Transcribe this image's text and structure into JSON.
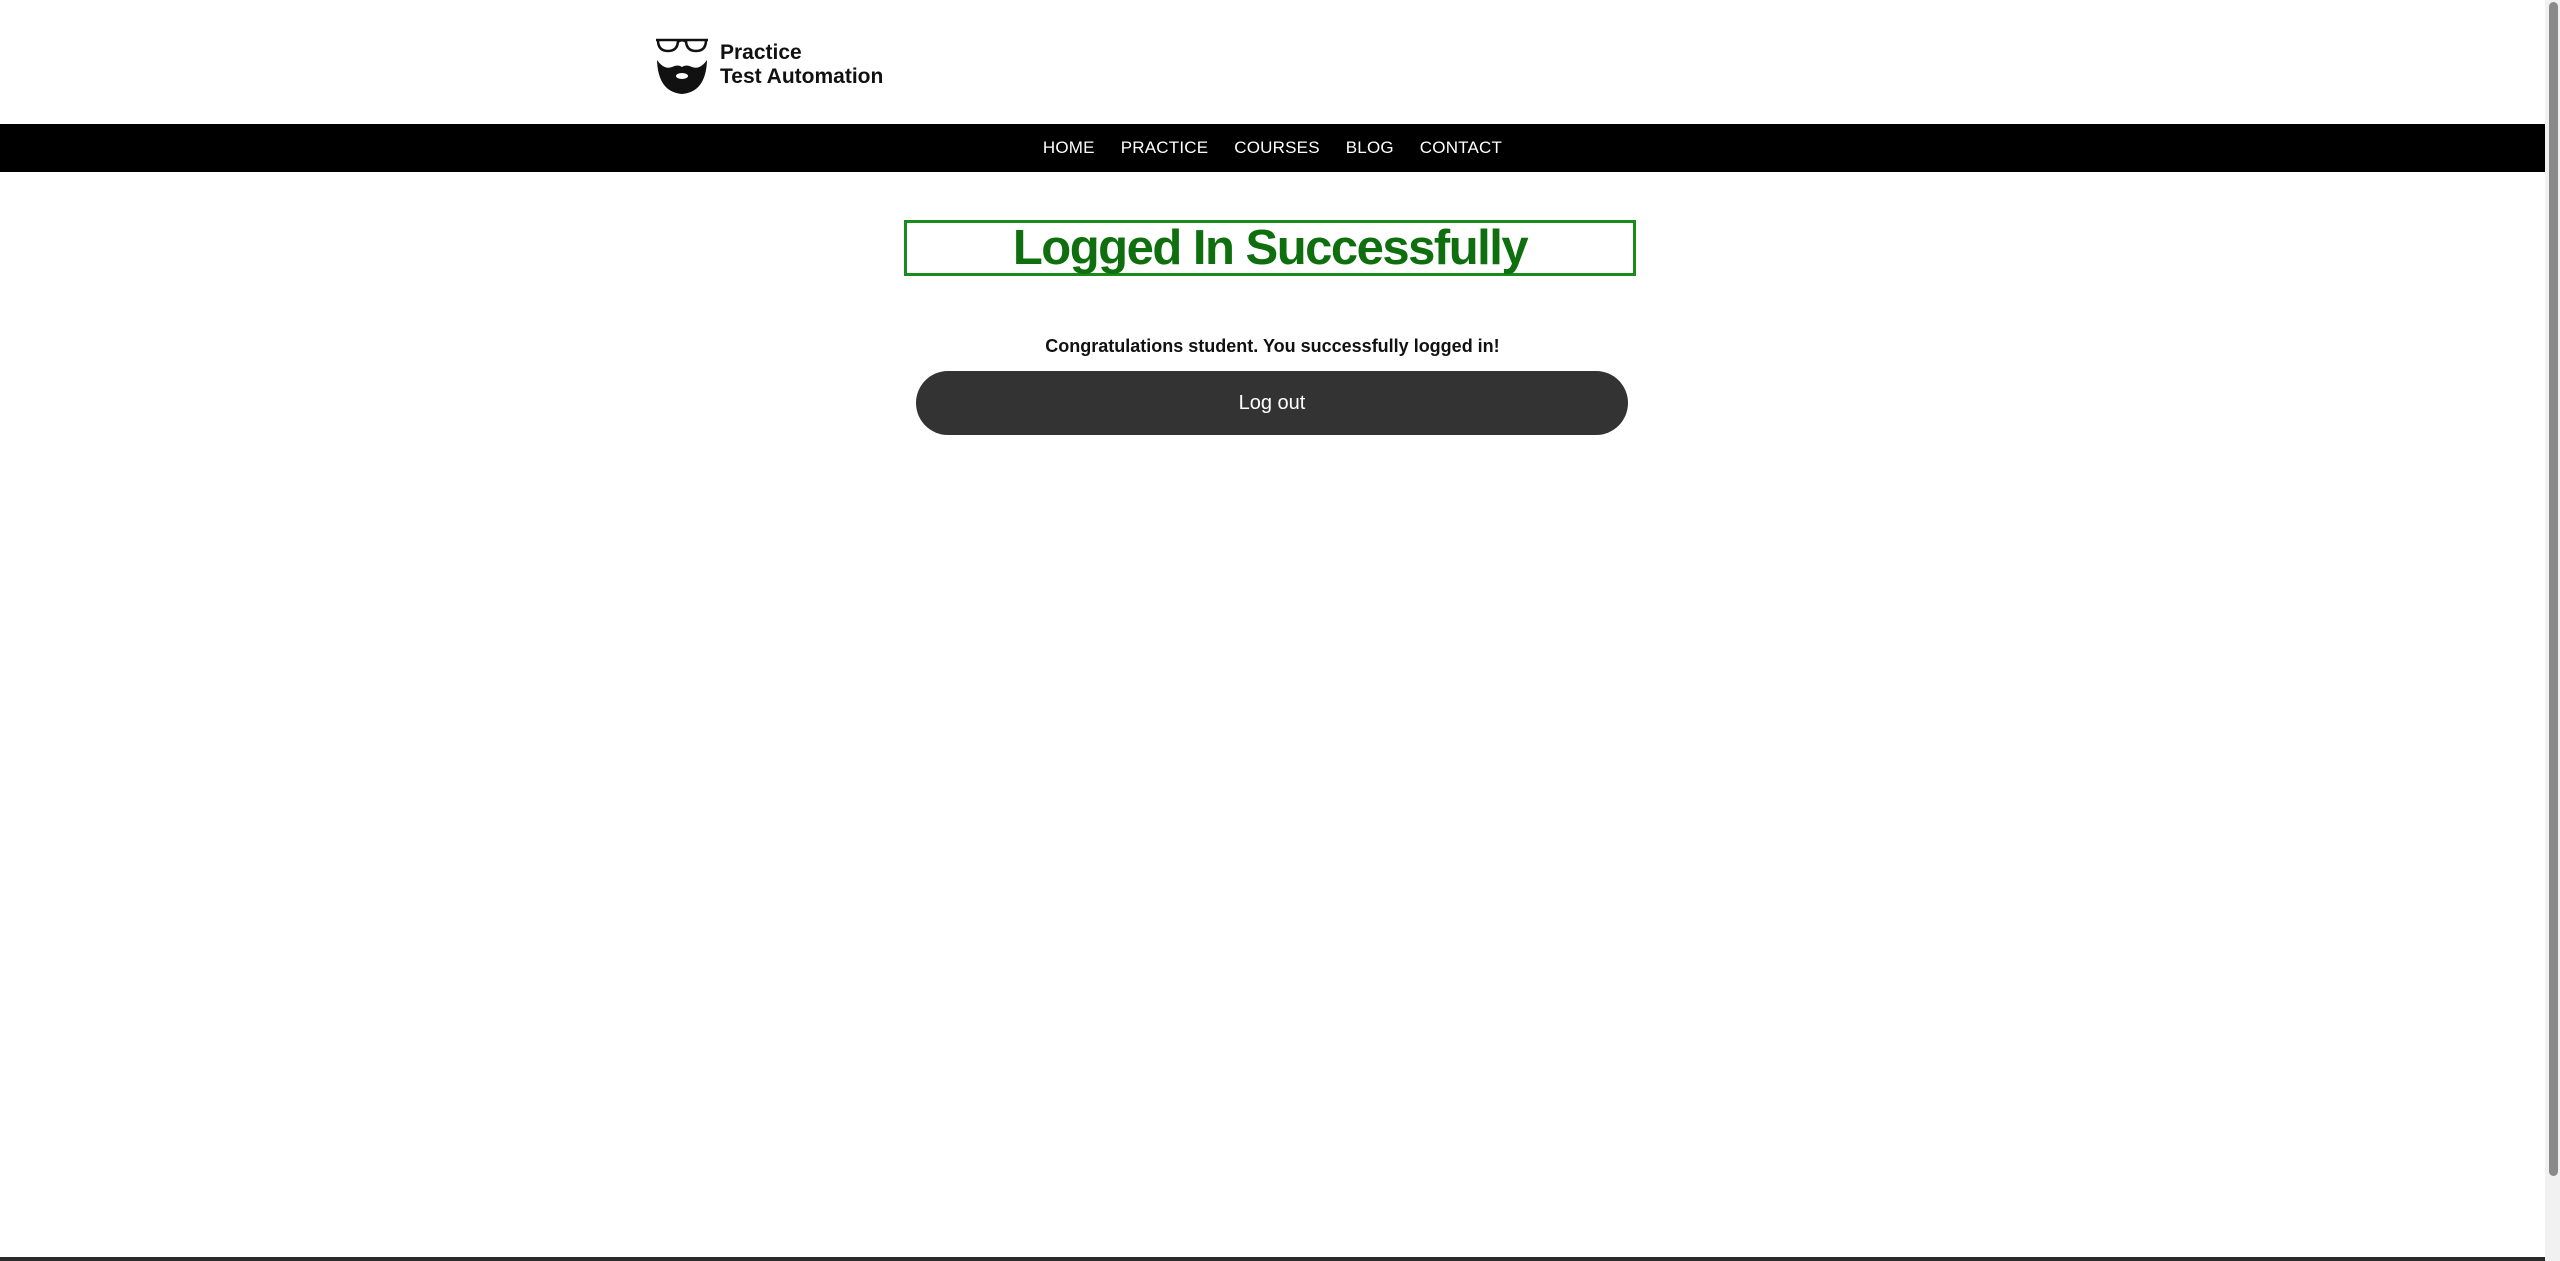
{
  "header": {
    "logo_line1": "Practice",
    "logo_line2": "Test Automation",
    "logo_icon": "bearded-face-glasses-icon"
  },
  "nav": {
    "items": [
      {
        "label": "HOME"
      },
      {
        "label": "PRACTICE"
      },
      {
        "label": "COURSES"
      },
      {
        "label": "BLOG"
      },
      {
        "label": "CONTACT"
      }
    ]
  },
  "main": {
    "title": "Logged In Successfully",
    "message": "Congratulations student. You successfully logged in!",
    "logout_label": "Log out"
  },
  "colors": {
    "title_green": "#0f6f0f",
    "title_border": "#1a8a1a",
    "nav_background": "#000000",
    "button_background": "#333333"
  }
}
